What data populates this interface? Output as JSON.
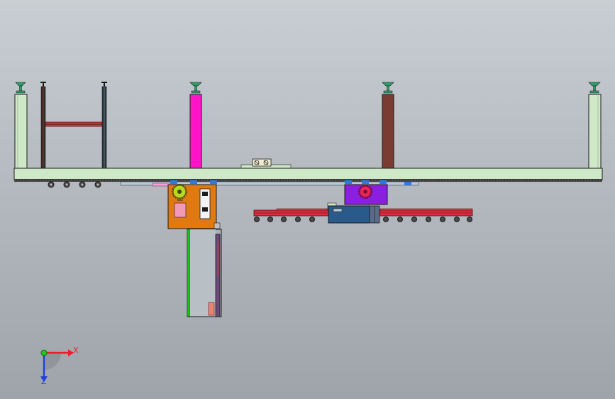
{
  "viewport": {
    "background_top": "#c9ced3",
    "background_bottom": "#9ea4aa"
  },
  "colors": {
    "frame_green": "#cfe8c8",
    "outline": "#1b1b1b",
    "magenta": "#ff14c8",
    "brown": "#7a3b32",
    "dark_red": "#6b1a1a",
    "orange": "#e07a10",
    "purple": "#8a1fe0",
    "rail_red": "#d83040",
    "teal_box": "#2a5a8a",
    "green_rod": "#1cc21c",
    "pink_block": "#f29ab5",
    "yellow_green_gear": "#b8d826",
    "gear_pink": "#e8245a",
    "axis_x": "#e8202a",
    "axis_y": "#1ec81e",
    "axis_z": "#2040e0"
  },
  "icons": {
    "triad": "coordinate-triad-icon",
    "leveling_foot": "leveling-foot-icon",
    "gear": "gear-icon",
    "roller": "roller-icon"
  },
  "triad": {
    "x_label": "X",
    "z_label": "Z"
  }
}
